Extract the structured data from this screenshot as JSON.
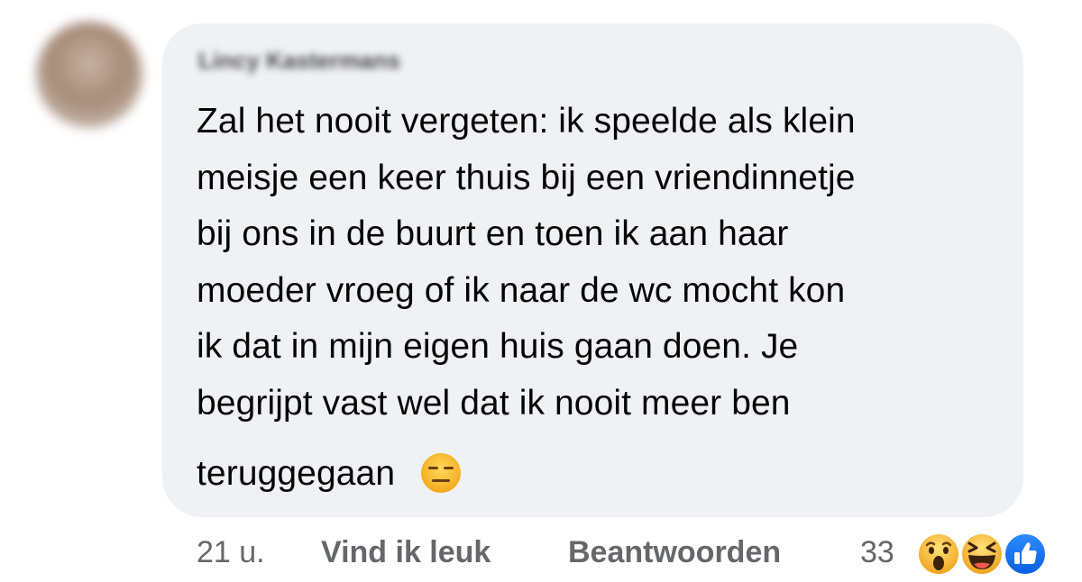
{
  "comment": {
    "lines": [
      "Zal het nooit vergeten: ik speelde als klein",
      "meisje een keer thuis bij een vriendinnetje",
      "bij ons in de buurt en toen ik aan haar",
      "moeder vroeg of ik naar de wc mocht kon",
      "ik dat in mijn eigen huis gaan doen. Je",
      "begrijpt vast wel dat ik nooit meer ben",
      "teruggegaan"
    ],
    "emoji": "expressionless-face-icon"
  },
  "meta": {
    "time": "21 u.",
    "like_label": "Vind ik leuk",
    "reply_label": "Beantwoorden",
    "reaction_count": "33"
  },
  "reactions": [
    "wow-icon",
    "haha-icon",
    "like-icon"
  ],
  "colors": {
    "bubble": "#f0f1f5",
    "text": "#050505",
    "meta_text": "#65676b",
    "like_blue": "#1b74e4",
    "emoji_yellow": "#f7c13a"
  }
}
